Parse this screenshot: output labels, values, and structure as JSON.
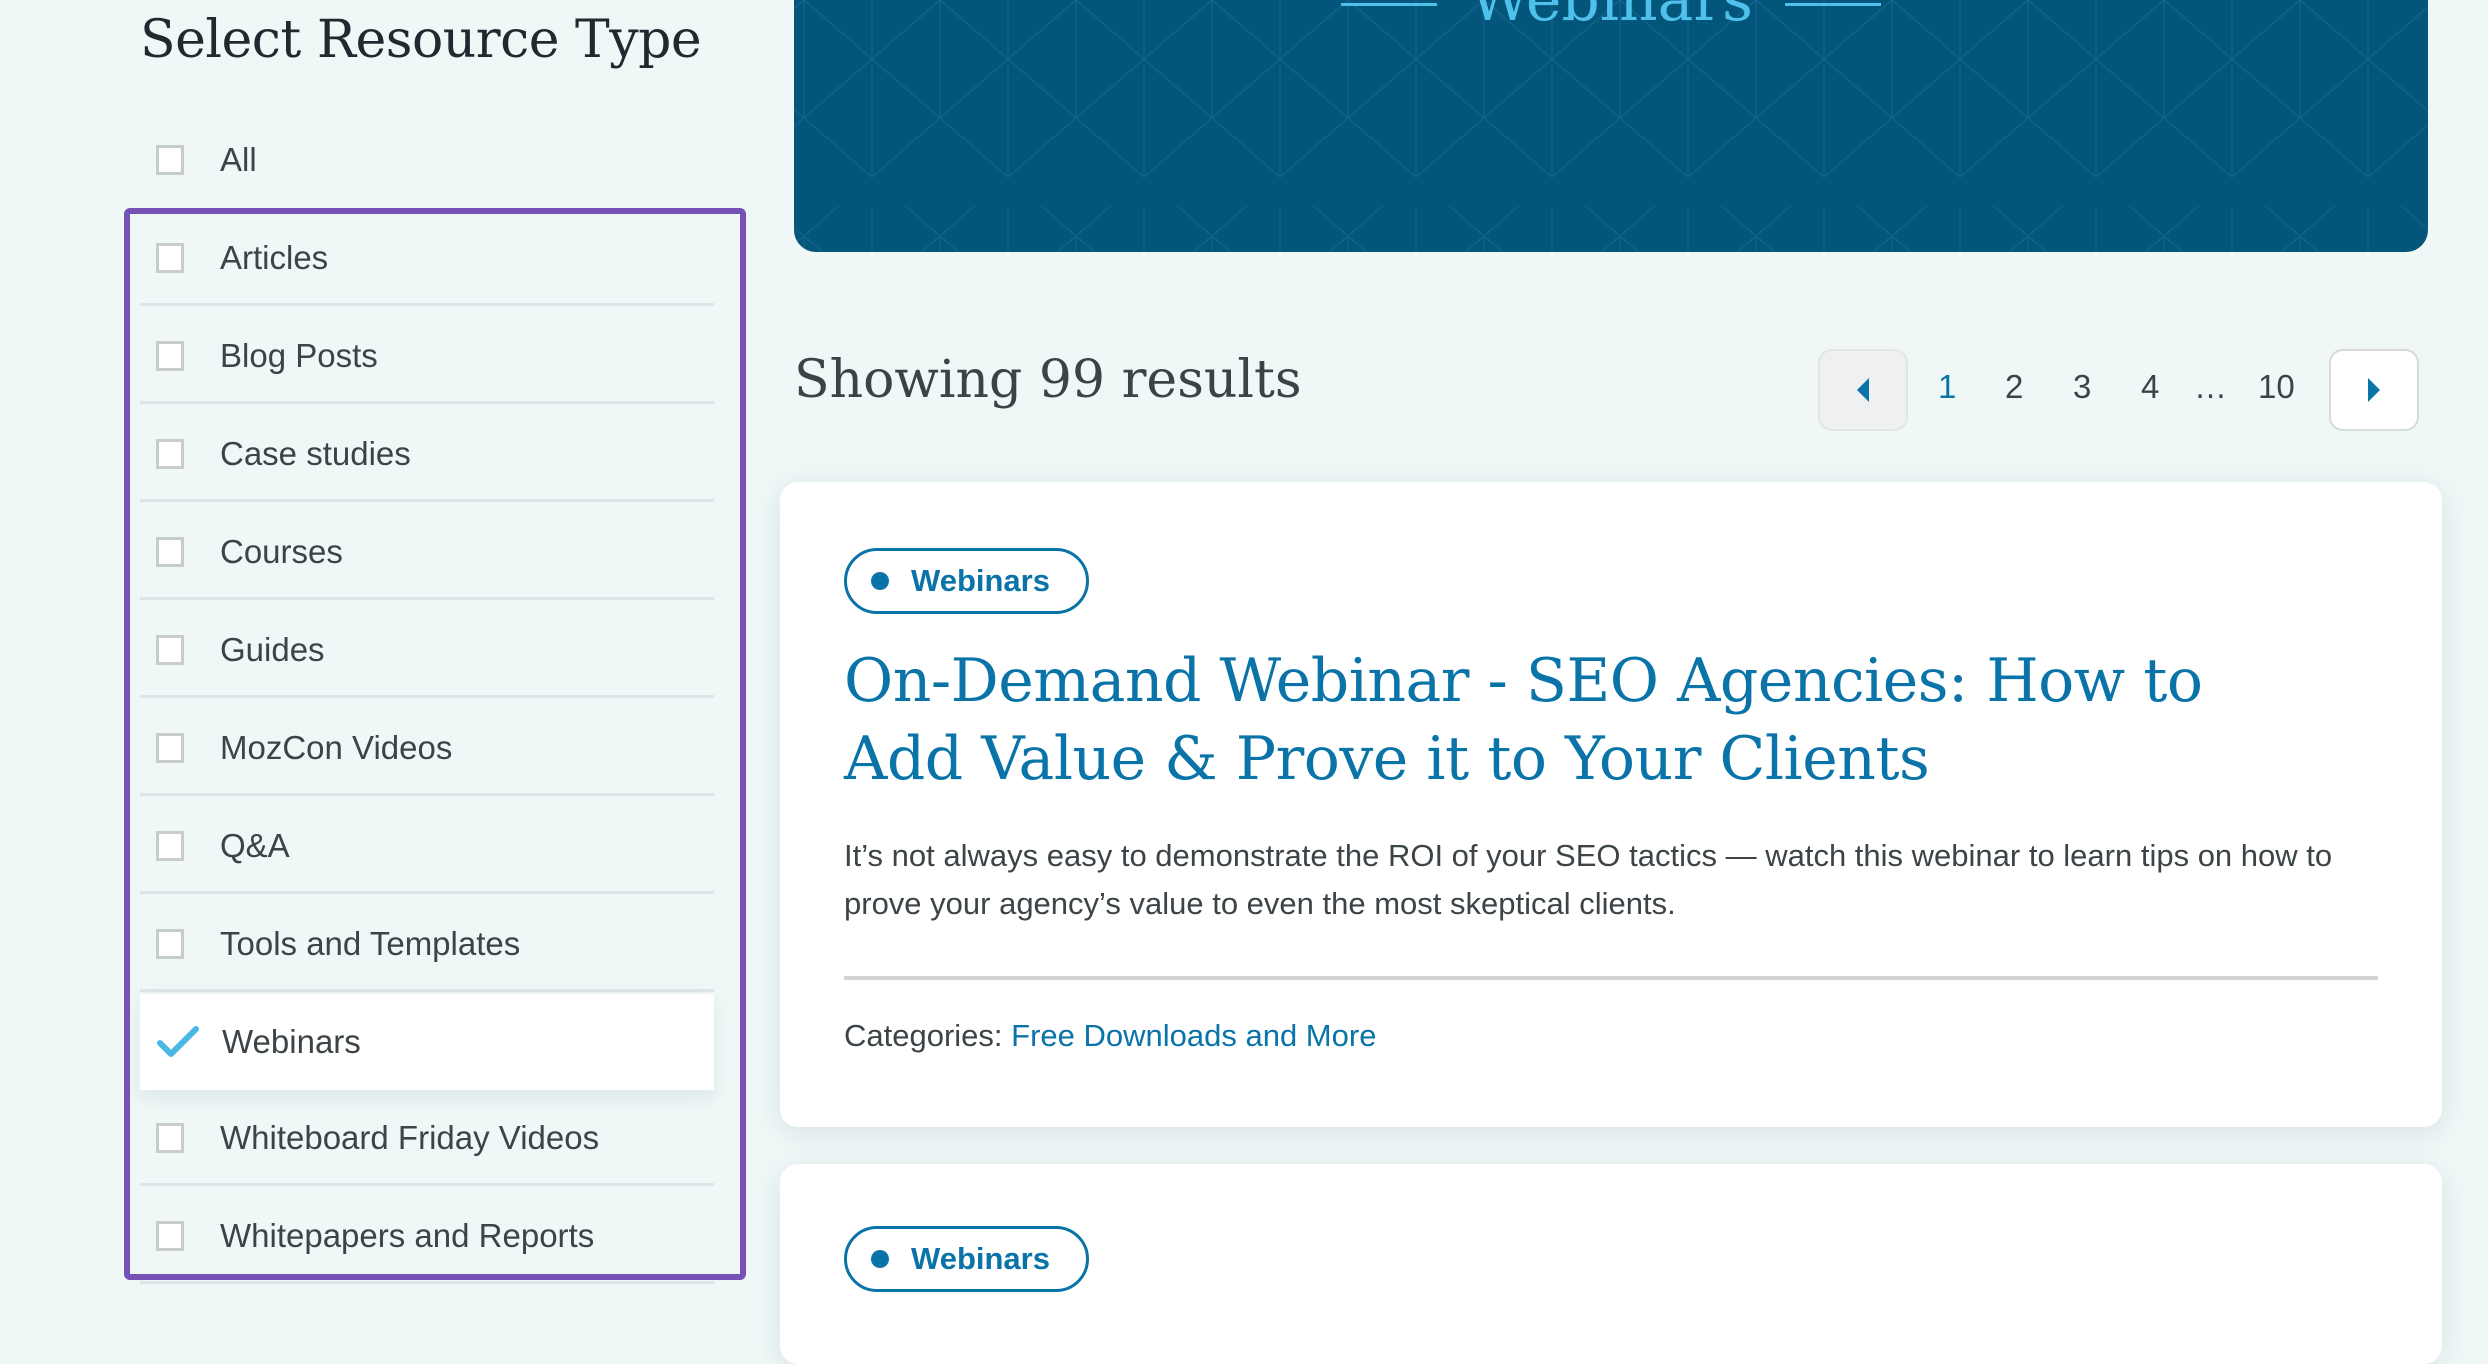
{
  "sidebar": {
    "title": "Select Resource Type",
    "all": {
      "label": "All",
      "checked": false
    },
    "items": [
      {
        "label": "Articles",
        "checked": false
      },
      {
        "label": "Blog Posts",
        "checked": false
      },
      {
        "label": "Case studies",
        "checked": false
      },
      {
        "label": "Courses",
        "checked": false
      },
      {
        "label": "Guides",
        "checked": false
      },
      {
        "label": "MozCon Videos",
        "checked": false
      },
      {
        "label": "Q&A",
        "checked": false
      },
      {
        "label": "Tools and Templates",
        "checked": false
      },
      {
        "label": "Webinars",
        "checked": true
      },
      {
        "label": "Whiteboard Friday Videos",
        "checked": false
      },
      {
        "label": "Whitepapers and Reports",
        "checked": false
      }
    ],
    "highlight_color": "#7651b6"
  },
  "banner": {
    "title": "Webinars",
    "bg_color": "#03557a",
    "accent_color": "#4fc0ec"
  },
  "results": {
    "count_text": "Showing 99 results"
  },
  "pagination": {
    "pages": [
      "1",
      "2",
      "3",
      "4",
      "…",
      "10"
    ],
    "current": "1",
    "prev_icon": "caret-left-icon",
    "next_icon": "caret-right-icon"
  },
  "cards": [
    {
      "tag": "Webinars",
      "title": "On-Demand Webinar - SEO Agencies: How to Add Value & Prove it to Your Clients",
      "description": "It’s not always easy to demonstrate the ROI of your SEO tactics — watch this webinar to learn tips on how to prove your agency’s value to even the most skeptical clients.",
      "categories_label": "Categories:",
      "category": "Free Downloads and More"
    },
    {
      "tag": "Webinars"
    }
  ],
  "colors": {
    "link": "#0a73a8",
    "check": "#4ab8e3",
    "page_bg": "#eff7f7"
  }
}
